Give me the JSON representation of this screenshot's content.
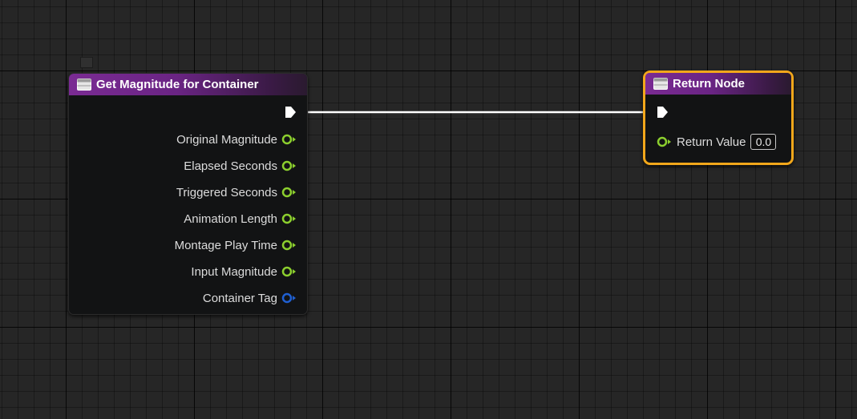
{
  "nodes": {
    "get_magnitude": {
      "title": "Get Magnitude for Container",
      "header_color": "#7a2b93",
      "icon": "function-icon",
      "output_pins": [
        {
          "label": "Original Magnitude",
          "type": "float",
          "color": "#8ccf2e"
        },
        {
          "label": "Elapsed Seconds",
          "type": "float",
          "color": "#8ccf2e"
        },
        {
          "label": "Triggered Seconds",
          "type": "float",
          "color": "#8ccf2e"
        },
        {
          "label": "Animation Length",
          "type": "float",
          "color": "#8ccf2e"
        },
        {
          "label": "Montage Play Time",
          "type": "float",
          "color": "#8ccf2e"
        },
        {
          "label": "Input Magnitude",
          "type": "float",
          "color": "#8ccf2e"
        },
        {
          "label": "Container Tag",
          "type": "struct",
          "color": "#1f5fd1"
        }
      ]
    },
    "return_node": {
      "title": "Return Node",
      "header_color": "#7a2b93",
      "selected_border_color": "#f2a71b",
      "icon": "function-icon",
      "input_pins": [
        {
          "label": "Return Value",
          "type": "float",
          "color": "#8ccf2e",
          "value": "0.0"
        }
      ]
    }
  },
  "colors": {
    "graph_background": "#262626",
    "exec_wire": "#ffffff",
    "float_pin": "#8ccf2e",
    "struct_pin": "#1f5fd1"
  }
}
